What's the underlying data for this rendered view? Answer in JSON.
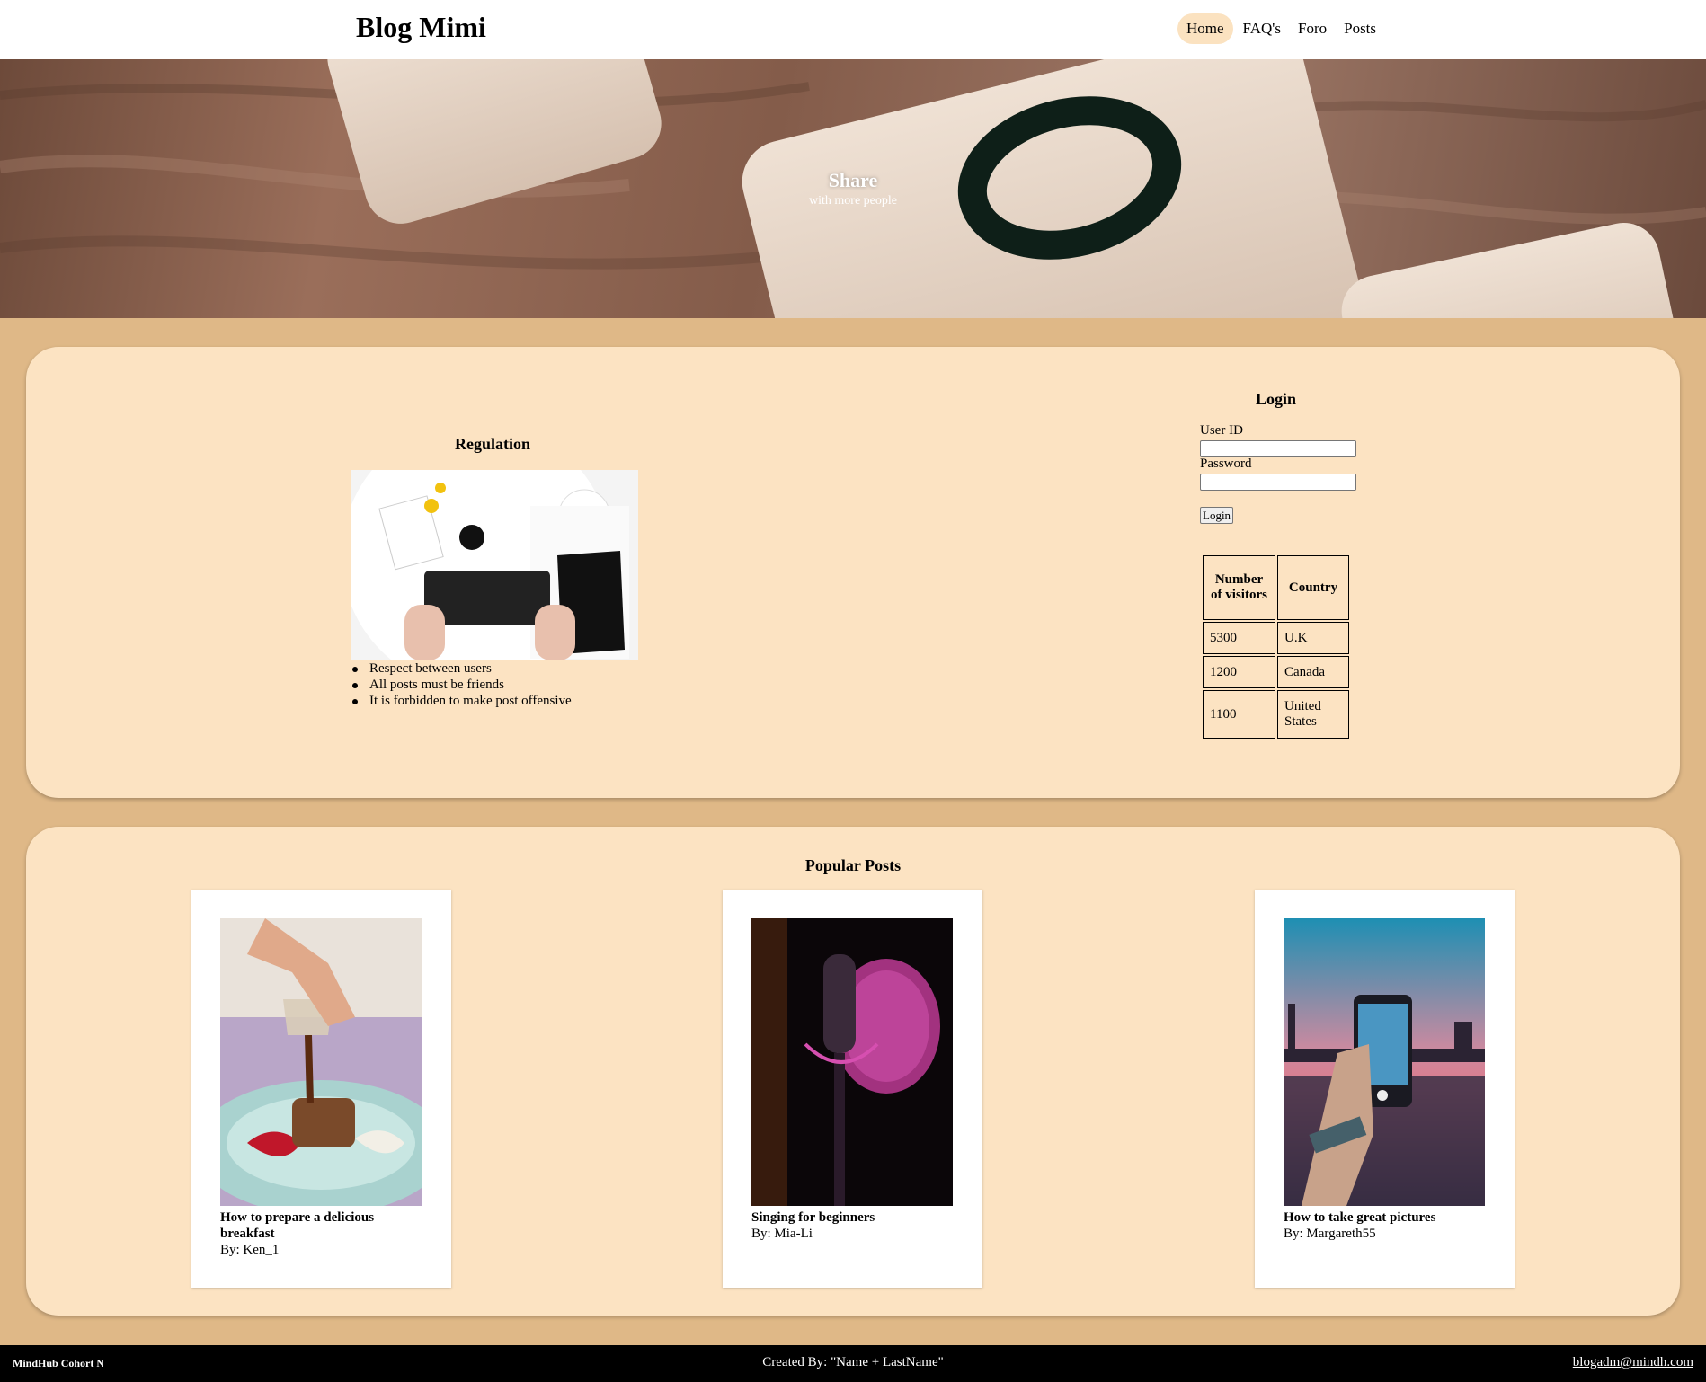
{
  "header": {
    "brand": "Blog Mimi",
    "nav": [
      {
        "label": "Home",
        "active": true
      },
      {
        "label": "FAQ's"
      },
      {
        "label": "Foro"
      },
      {
        "label": "Posts"
      }
    ]
  },
  "hero": {
    "title": "Share",
    "subtitle": "with more people"
  },
  "regulation": {
    "title": "Regulation",
    "rules": [
      "Respect between users",
      "All posts must be friends",
      "It is forbidden to make post offensive"
    ]
  },
  "login": {
    "title": "Login",
    "user_label": "User ID",
    "user_value": "",
    "password_label": "Password",
    "password_value": "",
    "button_label": "Login"
  },
  "visitors_table": {
    "headers": [
      "Number of visitors",
      "Country"
    ],
    "rows": [
      [
        "5300",
        "U.K"
      ],
      [
        "1200",
        "Canada"
      ],
      [
        "1100",
        "United States"
      ]
    ]
  },
  "popular": {
    "title": "Popular Posts",
    "posts": [
      {
        "title": "How to prepare a delicious breakfast",
        "author": "By: Ken_1"
      },
      {
        "title": "Singing for beginners",
        "author": "By: Mia-Li"
      },
      {
        "title": "How to take great pictures",
        "author": "By: Margareth55"
      }
    ]
  },
  "footer": {
    "left": "MindHub Cohort N",
    "center": "Created By: \"Name + LastName\"",
    "email": "blogadm@mindh.com"
  },
  "colors": {
    "page_bg": "#dfb887",
    "panel_bg": "#fce3c2",
    "active_nav_bg": "#fbe2c0",
    "footer_bg": "#000000"
  }
}
